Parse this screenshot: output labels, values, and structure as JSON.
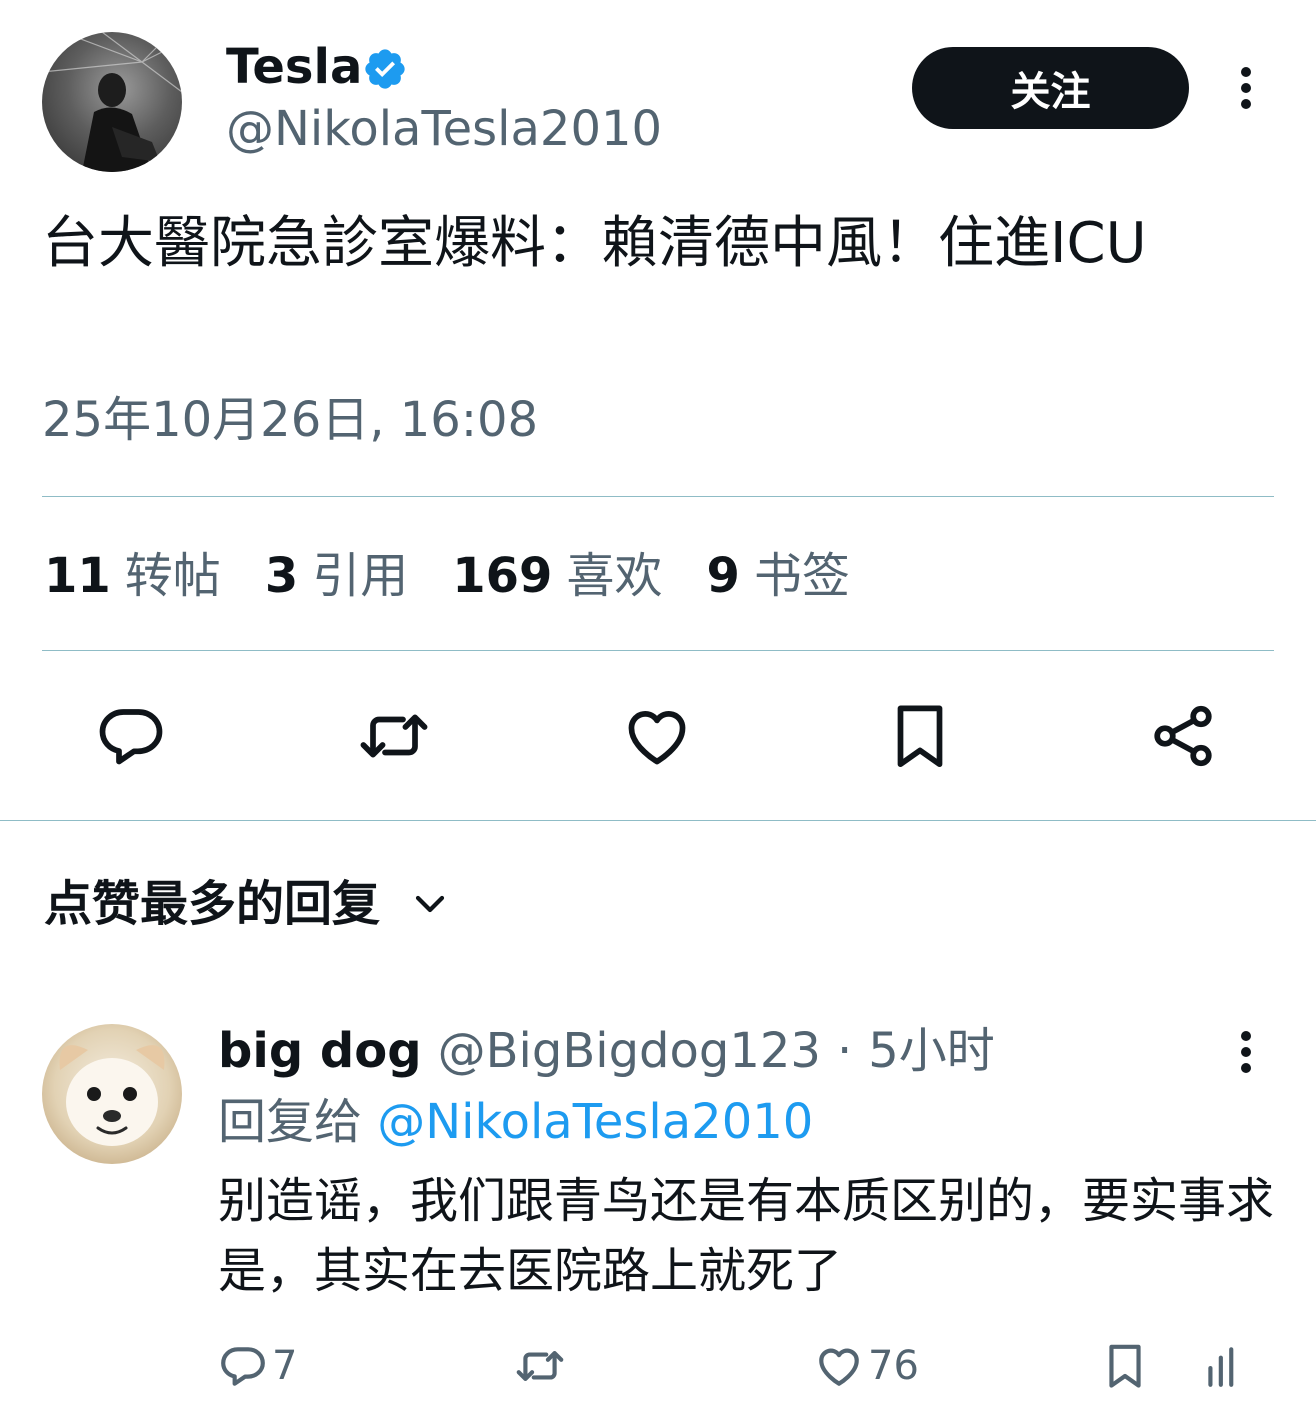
{
  "tweet": {
    "author_name": "Tesla",
    "author_handle": "@NikolaTesla2010",
    "follow_label": "关注",
    "text": "台大醫院急診室爆料：賴清德中風！住進ICU",
    "timestamp": "25年10月26日, 16:08",
    "stats": [
      {
        "count": "11",
        "label": "转帖"
      },
      {
        "count": "3",
        "label": "引用"
      },
      {
        "count": "169",
        "label": "喜欢"
      },
      {
        "count": "9",
        "label": "书签"
      }
    ]
  },
  "replies_section": {
    "sort_label": "点赞最多的回复"
  },
  "reply": {
    "author_name": "big dog",
    "author_handle": "@BigBigdog123",
    "separator": "·",
    "time": "5小时",
    "replying_to_prefix": "回复给 ",
    "replying_to_handle": "@NikolaTesla2010",
    "text": "别造谣，我们跟青鸟还是有本质区别的，要实事求是，其实在去医院路上就死了",
    "reply_count": "7",
    "like_count": "76"
  },
  "colors": {
    "text_primary": "#0f1419",
    "text_secondary": "#536471",
    "accent": "#1d9bf0",
    "divider": "#8fbcc6",
    "follow_button_bg": "#0f1419"
  }
}
